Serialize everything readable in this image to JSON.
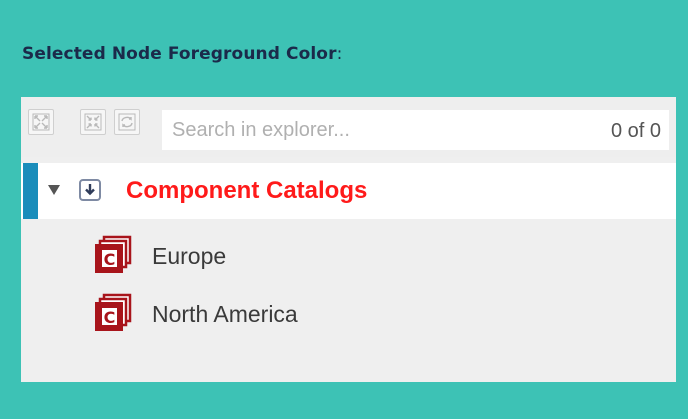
{
  "heading": {
    "label": "Selected Node Foreground Color",
    "suffix": ":"
  },
  "toolbar": {
    "buttons": [
      {
        "name": "expand-all-icon"
      },
      {
        "name": "collapse-all-icon"
      },
      {
        "name": "refresh-icon"
      }
    ],
    "search": {
      "placeholder": "Search in explorer...",
      "value": "",
      "count": "0 of 0"
    }
  },
  "tree": {
    "selected": {
      "label": "Component Catalogs",
      "color": "#ff1a1a",
      "icon": "download-box-icon",
      "expanded": true
    },
    "children": [
      {
        "label": "Europe",
        "icon": "catalog-icon"
      },
      {
        "label": "North America",
        "icon": "catalog-icon"
      }
    ]
  },
  "colors": {
    "background": "#3dc2b5",
    "selection_bar": "#1a8dbb",
    "heading_text": "#1b2a4a",
    "catalog_icon": "#a8141b"
  }
}
